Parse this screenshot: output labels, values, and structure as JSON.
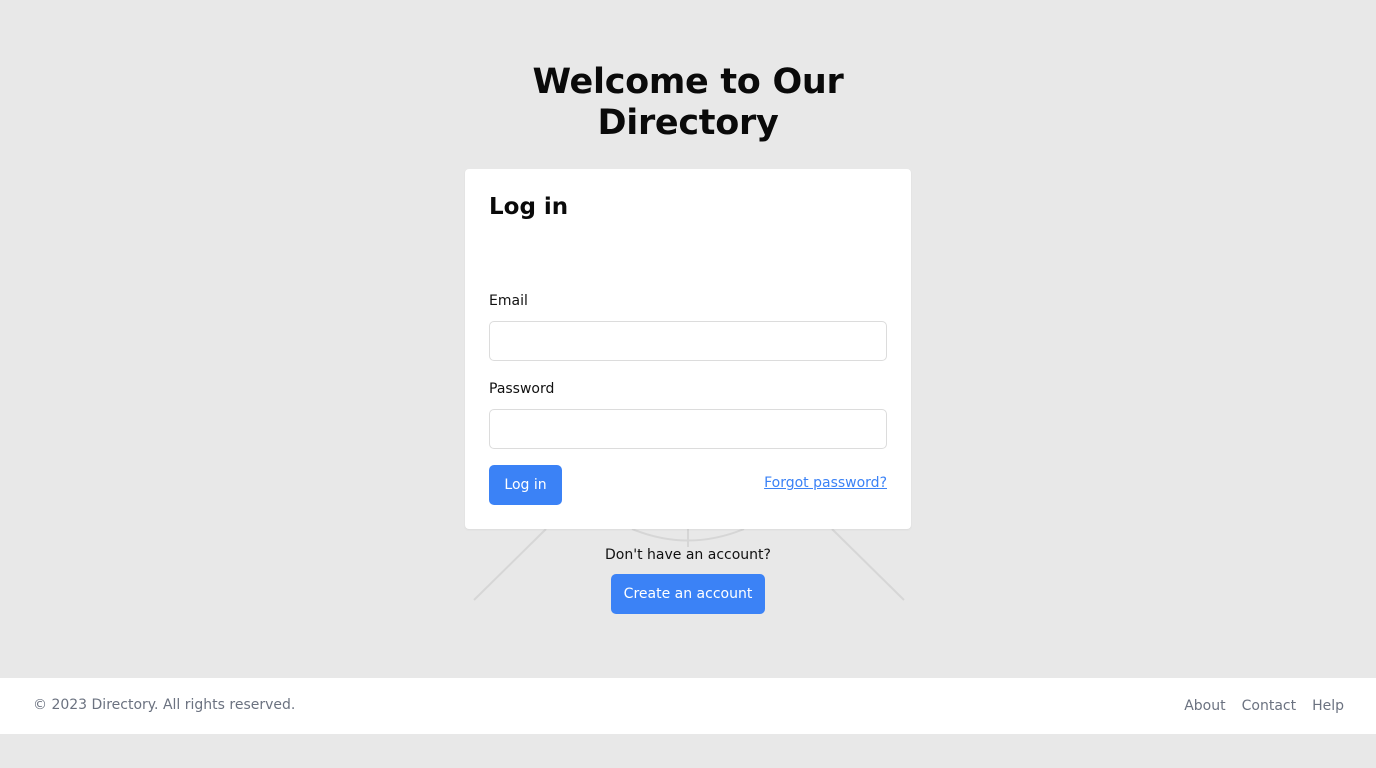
{
  "page": {
    "title_line1": "Welcome to Our",
    "title_line2": "Directory"
  },
  "login_card": {
    "title": "Log in",
    "email_label": "Email",
    "email_value": "",
    "password_label": "Password",
    "password_value": "",
    "submit_label": "Log in",
    "forgot_label": "Forgot password?"
  },
  "signup": {
    "prompt": "Don't have an account?",
    "button_label": "Create an account"
  },
  "footer": {
    "copyright": "© 2023 Directory. All rights reserved.",
    "links": [
      "About",
      "Contact",
      "Help"
    ]
  },
  "colors": {
    "background": "#e8e8e8",
    "card": "#ffffff",
    "accent": "#3b82f6",
    "muted_text": "#6b7280"
  }
}
